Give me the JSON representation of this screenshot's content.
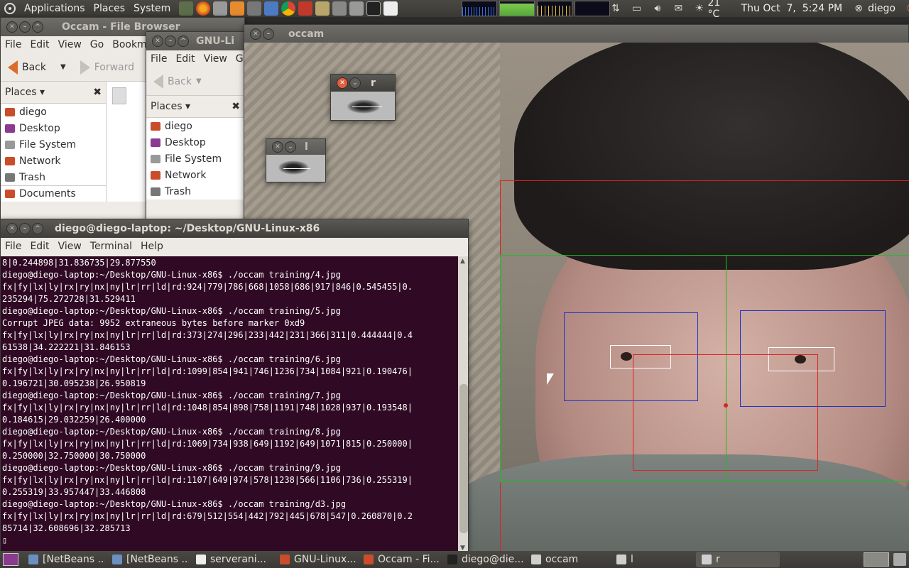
{
  "top_panel": {
    "menus": [
      "Applications",
      "Places",
      "System"
    ],
    "launcher_icons": [
      "terminal-app-icon",
      "firefox-icon",
      "settings-icon",
      "butterfly-icon",
      "monitor-icon",
      "cube-icon",
      "chrome-icon",
      "phone-icon",
      "folder-icon",
      "calculator-icon",
      "camera-icon",
      "terminal-icon",
      "text-editor-icon"
    ],
    "weather": "21 °C",
    "clock": "Thu Oct  7,  5:24 PM",
    "user": "diego"
  },
  "file_browser": {
    "title": "Occam - File Browser",
    "menu": [
      "File",
      "Edit",
      "View",
      "Go",
      "Bookmar"
    ],
    "back_label": "Back",
    "forward_label": "Forward",
    "places_label": "Places",
    "places": [
      "diego",
      "Desktop",
      "File System",
      "Network",
      "Trash",
      "Documents"
    ]
  },
  "gnu_browser": {
    "title": "GNU-Li",
    "menu": [
      "File",
      "Edit",
      "View",
      "Go"
    ],
    "back_label": "Back",
    "places_label": "Places",
    "places": [
      "diego",
      "Desktop",
      "File System",
      "Network",
      "Trash"
    ]
  },
  "occam_window": {
    "title": "occam"
  },
  "eye_r": {
    "title": "r"
  },
  "eye_l": {
    "title": "l"
  },
  "terminal": {
    "title": "diego@diego-laptop: ~/Desktop/GNU-Linux-x86",
    "menu": [
      "File",
      "Edit",
      "View",
      "Terminal",
      "Help"
    ],
    "lines": [
      "8|0.244898|31.836735|29.877550",
      "diego@diego-laptop:~/Desktop/GNU-Linux-x86$ ./occam training/4.jpg",
      "fx|fy|lx|ly|rx|ry|nx|ny|lr|rr|ld|rd:924|779|786|668|1058|686|917|846|0.545455|0.",
      "235294|75.272728|31.529411",
      "diego@diego-laptop:~/Desktop/GNU-Linux-x86$ ./occam training/5.jpg",
      "Corrupt JPEG data: 9952 extraneous bytes before marker 0xd9",
      "fx|fy|lx|ly|rx|ry|nx|ny|lr|rr|ld|rd:373|274|296|233|442|231|366|311|0.444444|0.4",
      "61538|34.222221|31.846153",
      "diego@diego-laptop:~/Desktop/GNU-Linux-x86$ ./occam training/6.jpg",
      "fx|fy|lx|ly|rx|ry|nx|ny|lr|rr|ld|rd:1099|854|941|746|1236|734|1084|921|0.190476|",
      "0.196721|30.095238|26.950819",
      "diego@diego-laptop:~/Desktop/GNU-Linux-x86$ ./occam training/7.jpg",
      "fx|fy|lx|ly|rx|ry|nx|ny|lr|rr|ld|rd:1048|854|898|758|1191|748|1028|937|0.193548|",
      "0.184615|29.032259|26.400000",
      "diego@diego-laptop:~/Desktop/GNU-Linux-x86$ ./occam training/8.jpg",
      "fx|fy|lx|ly|rx|ry|nx|ny|lr|rr|ld|rd:1069|734|938|649|1192|649|1071|815|0.250000|",
      "0.250000|32.750000|30.750000",
      "diego@diego-laptop:~/Desktop/GNU-Linux-x86$ ./occam training/9.jpg",
      "fx|fy|lx|ly|rx|ry|nx|ny|lr|rr|ld|rd:1107|649|974|578|1238|566|1106|736|0.255319|",
      "0.255319|33.957447|33.446808",
      "diego@diego-laptop:~/Desktop/GNU-Linux-x86$ ./occam training/d3.jpg",
      "fx|fy|lx|ly|rx|ry|nx|ny|lr|rr|ld|rd:679|512|554|442|792|445|678|547|0.260870|0.2",
      "85714|32.608696|32.285713",
      "▯"
    ]
  },
  "taskbar": {
    "items": [
      {
        "label": "[NetBeans ...",
        "icon": "netbeans-icon"
      },
      {
        "label": "[NetBeans ...",
        "icon": "netbeans-icon"
      },
      {
        "label": "serverani...",
        "icon": "text-editor-icon"
      },
      {
        "label": "GNU-Linux...",
        "icon": "folder-icon"
      },
      {
        "label": "Occam - Fi...",
        "icon": "folder-icon"
      },
      {
        "label": "diego@die...",
        "icon": "terminal-icon"
      },
      {
        "label": "occam",
        "icon": "window-icon"
      },
      {
        "label": "l",
        "icon": "window-icon"
      },
      {
        "label": "r",
        "icon": "window-icon"
      }
    ]
  },
  "colors": {
    "face_box": "#dd2222",
    "eye_box": "#2233cc",
    "half_box": "#22bb22",
    "pupil_box": "#ffffff",
    "terminal_bg": "#300a24"
  }
}
